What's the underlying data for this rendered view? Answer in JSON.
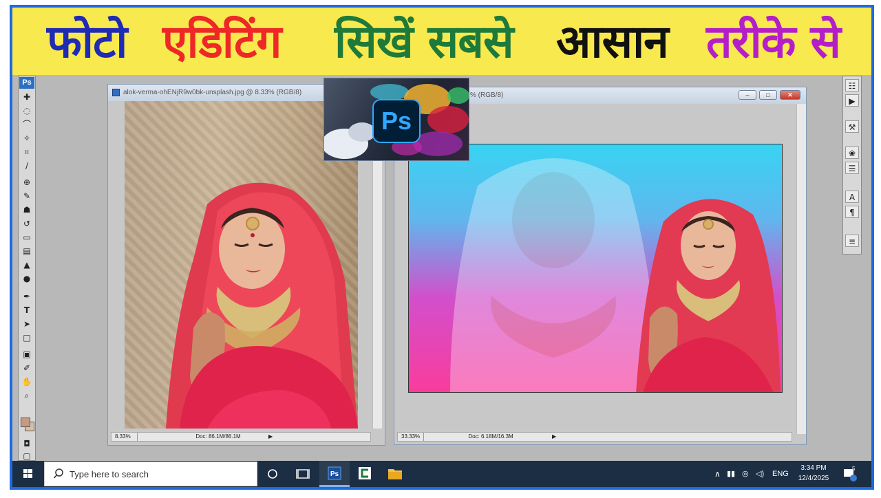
{
  "banner": {
    "words": [
      "फोटो",
      "एडिटिंग",
      "सिखें सबसे",
      "आसान",
      "तरीके से"
    ],
    "colors": [
      "#1f2ab5",
      "#ee2727",
      "#1e7a3a",
      "#111111",
      "#b31ec9"
    ],
    "background": "#f7e94e"
  },
  "toolbox": {
    "badge": "Ps",
    "tools": [
      "move-tool",
      "marquee-tool",
      "lasso-tool",
      "magic-wand-tool",
      "crop-tool",
      "slice-tool",
      "healing-brush-tool",
      "brush-tool",
      "clone-stamp-tool",
      "history-brush-tool",
      "eraser-tool",
      "gradient-tool",
      "blur-tool",
      "dodge-tool",
      "pen-tool",
      "type-tool",
      "path-selection-tool",
      "shape-tool",
      "notes-tool",
      "eyedropper-tool",
      "hand-tool",
      "zoom-tool"
    ],
    "type_glyph": "T",
    "foreground_color": "#c79a82",
    "background_color": "#d8c0a8"
  },
  "doc1": {
    "title": "alok-verma-ohENjR9w0bk-unsplash.jpg @ 8.33% (RGB/8)",
    "zoom": "8.33%",
    "doc_info": "Doc: 86.1M/86.1M"
  },
  "doc2": {
    "title": "% (RGB/8)",
    "zoom": "33.33%",
    "doc_info": "Doc: 6.18M/16.3M"
  },
  "ps_logo": {
    "text": "Ps"
  },
  "right_panel": {
    "tools": [
      "navigator-icon",
      "actions-icon",
      "tool-presets-icon",
      "brushes-icon",
      "layer-comps-icon",
      "character-icon",
      "paragraph-icon",
      "layers-icon"
    ],
    "character_glyph": "A",
    "paragraph_glyph": "¶"
  },
  "taskbar": {
    "search_placeholder": "Type here to search",
    "language": "ENG",
    "time": "3:34 PM",
    "date": "12/4/2025",
    "notification_count": "5"
  }
}
